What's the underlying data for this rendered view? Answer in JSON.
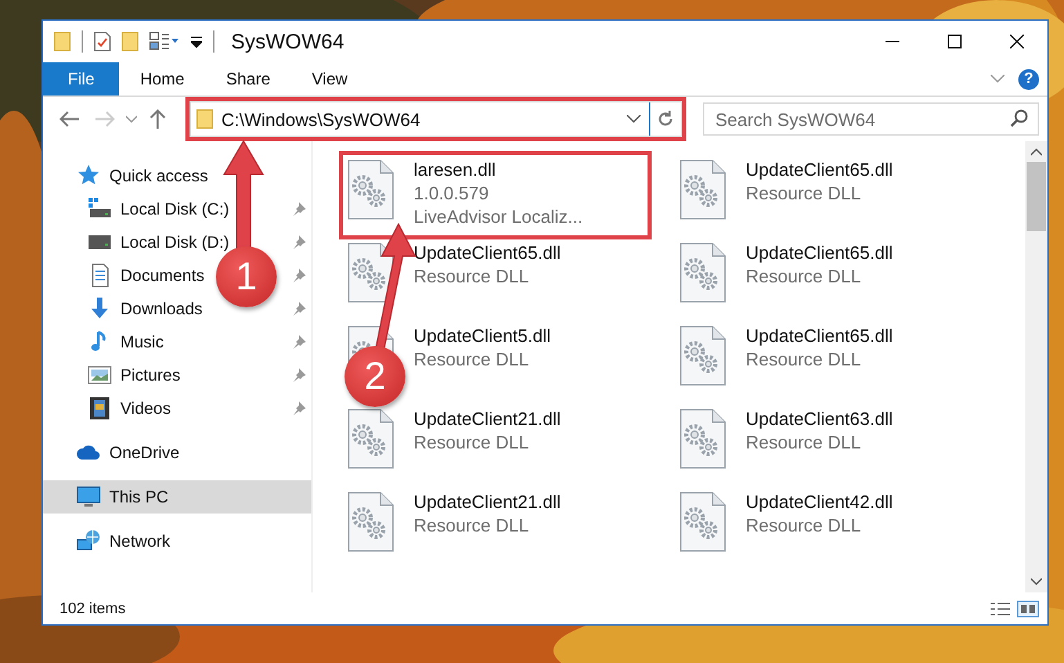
{
  "window": {
    "title": "SysWOW64"
  },
  "ribbon": {
    "tabs": [
      {
        "label": "File",
        "selected": true
      },
      {
        "label": "Home",
        "selected": false
      },
      {
        "label": "Share",
        "selected": false
      },
      {
        "label": "View",
        "selected": false
      }
    ],
    "help": "?"
  },
  "address_bar": {
    "path": "C:\\Windows\\SysWOW64",
    "highlighted": true
  },
  "search": {
    "placeholder": "Search SysWOW64"
  },
  "sidebar": {
    "items": [
      {
        "label": "Quick access",
        "selected": false,
        "children": [
          {
            "label": "Local Disk (C:)",
            "pinned": true,
            "selected": false
          },
          {
            "label": "Local Disk (D:)",
            "pinned": true,
            "selected": false
          },
          {
            "label": "Documents",
            "pinned": true,
            "selected": false
          },
          {
            "label": "Downloads",
            "pinned": true,
            "selected": false
          },
          {
            "label": "Music",
            "pinned": true,
            "selected": false
          },
          {
            "label": "Pictures",
            "pinned": true,
            "selected": false
          },
          {
            "label": "Videos",
            "pinned": true,
            "selected": false
          }
        ]
      },
      {
        "label": "OneDrive",
        "selected": false
      },
      {
        "label": "This PC",
        "selected": true
      },
      {
        "label": "Network",
        "selected": false
      }
    ]
  },
  "files": [
    {
      "name": "laresen.dll",
      "details": [
        "1.0.0.579",
        "LiveAdvisor Localiz..."
      ],
      "highlighted": true
    },
    {
      "name": "UpdateClient65.dll",
      "details": [
        "Resource DLL"
      ],
      "highlighted": false
    },
    {
      "name": "UpdateClient65.dll",
      "details": [
        "Resource DLL"
      ],
      "highlighted": false
    },
    {
      "name": "UpdateClient65.dll",
      "details": [
        "Resource DLL"
      ],
      "highlighted": false
    },
    {
      "name": "UpdateClient5.dll",
      "details": [
        "Resource DLL"
      ],
      "highlighted": false
    },
    {
      "name": "UpdateClient65.dll",
      "details": [
        "Resource DLL"
      ],
      "highlighted": false
    },
    {
      "name": "UpdateClient21.dll",
      "details": [
        "Resource DLL"
      ],
      "highlighted": false
    },
    {
      "name": "UpdateClient63.dll",
      "details": [
        "Resource DLL"
      ],
      "highlighted": false
    },
    {
      "name": "UpdateClient21.dll",
      "details": [
        "Resource DLL"
      ],
      "highlighted": false
    },
    {
      "name": "UpdateClient42.dll",
      "details": [
        "Resource DLL"
      ],
      "highlighted": false
    }
  ],
  "status_bar": {
    "count": "102 items"
  },
  "annotations": [
    {
      "number": "1"
    },
    {
      "number": "2"
    }
  ]
}
